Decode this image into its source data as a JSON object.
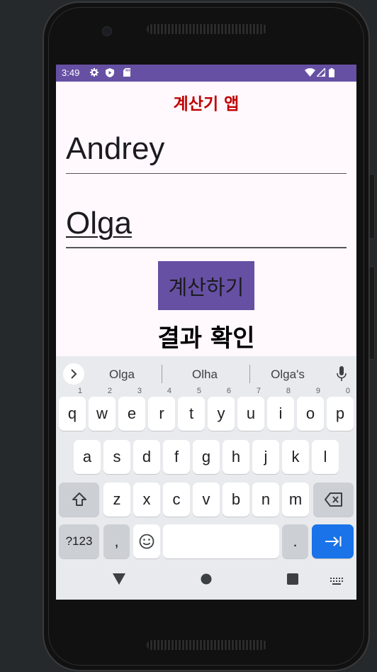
{
  "status_bar": {
    "time": "3:49"
  },
  "app": {
    "title": "계산기 앱",
    "name_field_1": "Andrey",
    "name_field_2": "Olga",
    "calculate_button": "계산하기",
    "result_label": "결과 확인"
  },
  "keyboard": {
    "suggestions": [
      "Olga",
      "Olha",
      "Olga's"
    ],
    "row1": [
      {
        "k": "q",
        "h": "1"
      },
      {
        "k": "w",
        "h": "2"
      },
      {
        "k": "e",
        "h": "3"
      },
      {
        "k": "r",
        "h": "4"
      },
      {
        "k": "t",
        "h": "5"
      },
      {
        "k": "y",
        "h": "6"
      },
      {
        "k": "u",
        "h": "7"
      },
      {
        "k": "i",
        "h": "8"
      },
      {
        "k": "o",
        "h": "9"
      },
      {
        "k": "p",
        "h": "0"
      }
    ],
    "row2": [
      "a",
      "s",
      "d",
      "f",
      "g",
      "h",
      "j",
      "k",
      "l"
    ],
    "row3": [
      "z",
      "x",
      "c",
      "v",
      "b",
      "n",
      "m"
    ],
    "sym_label": "?123",
    "comma_label": ",",
    "period_label": "."
  },
  "colors": {
    "accent": "#6650a4",
    "title_red": "#c00000",
    "enter_blue": "#1a73e8",
    "background": "#fff8fd"
  },
  "icons": {
    "status": [
      "settings-icon",
      "play-protect-icon",
      "sd-card-icon",
      "wifi-icon",
      "signal-icon",
      "battery-icon"
    ],
    "keyboard": [
      "expand-suggestions-icon",
      "mic-icon",
      "shift-icon",
      "backspace-icon",
      "emoji-icon",
      "enter-icon"
    ],
    "nav": [
      "back-icon",
      "home-icon",
      "recents-icon",
      "keyboard-switch-icon"
    ]
  }
}
